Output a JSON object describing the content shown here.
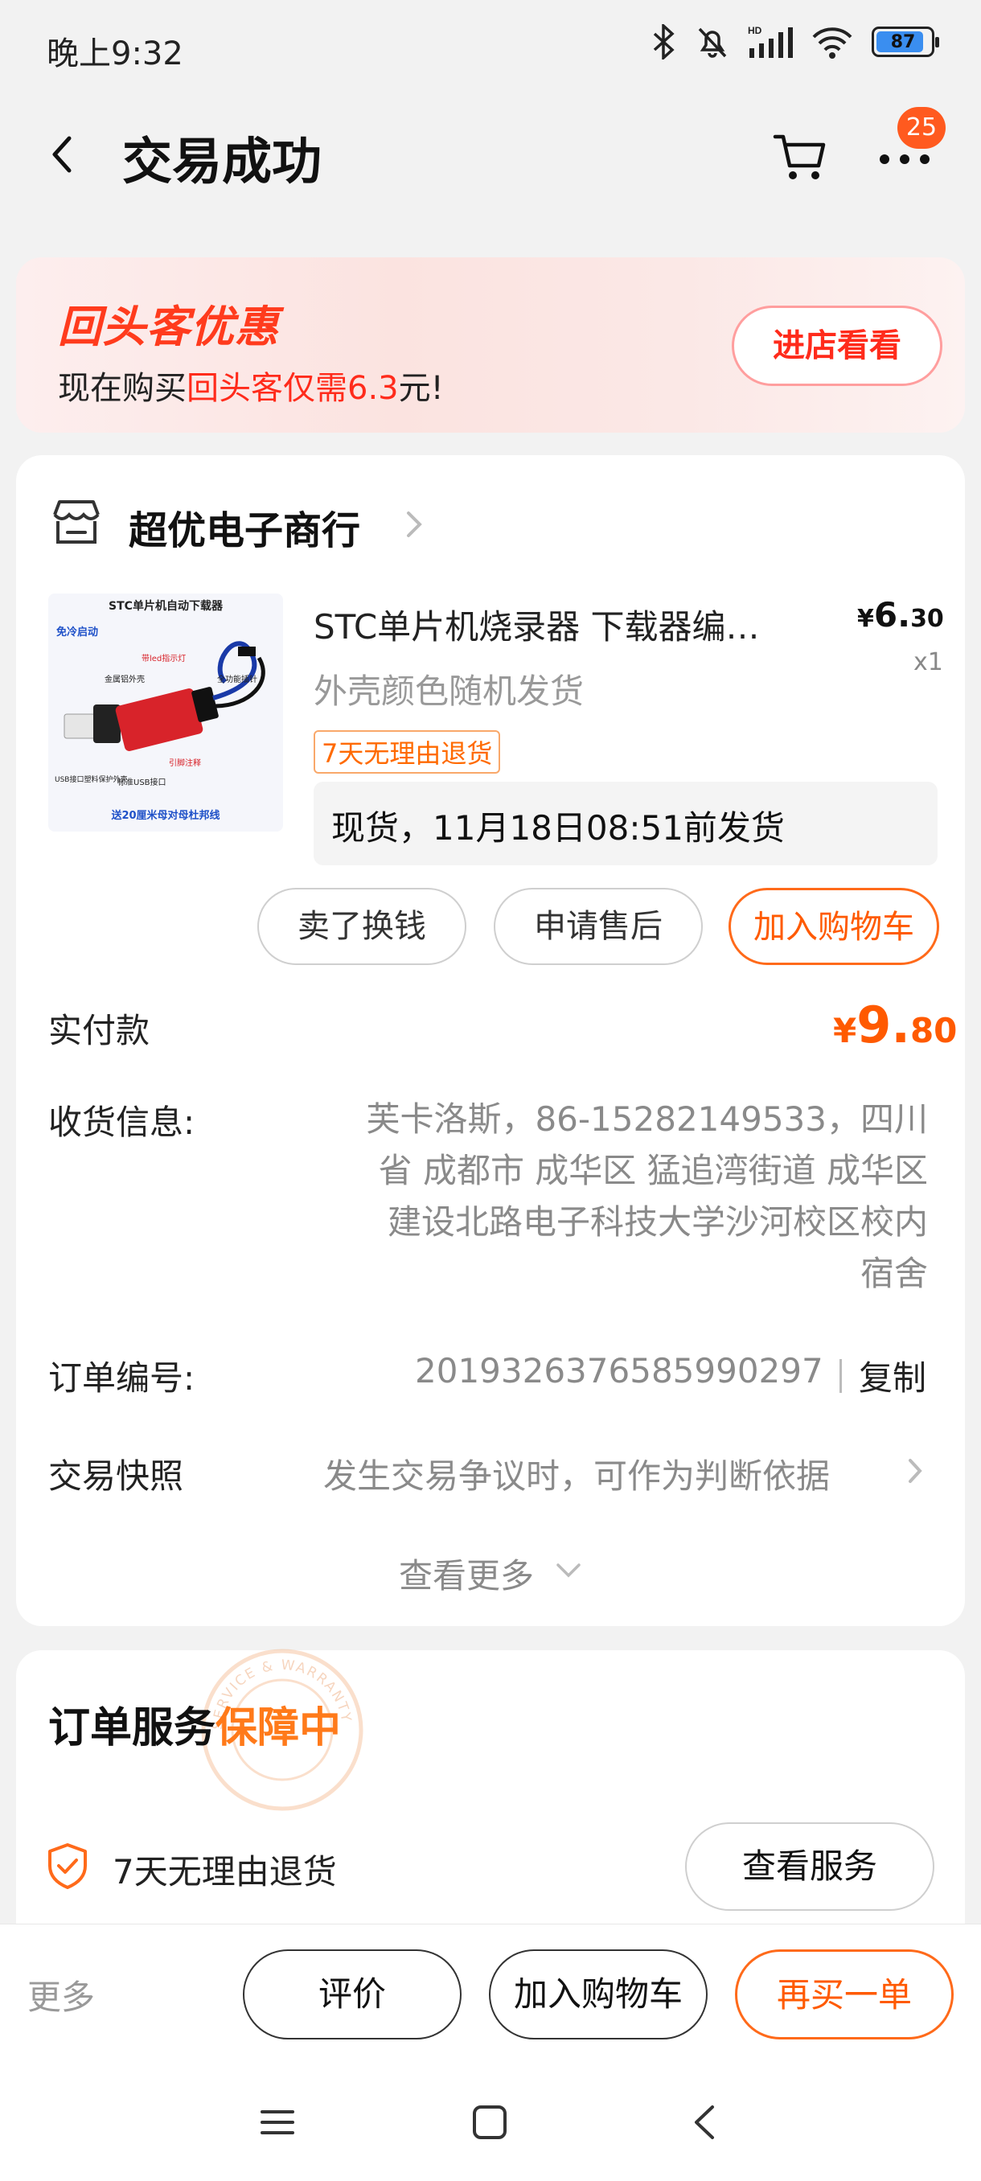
{
  "status_bar": {
    "time": "晚上9:32",
    "battery": "87"
  },
  "header": {
    "title": "交易成功",
    "badge_count": "25"
  },
  "promo": {
    "logo": "回头客优惠",
    "text_prefix": "现在购买",
    "text_highlight": "回头客仅需6.3",
    "text_suffix": "元!",
    "button": "进店看看"
  },
  "store": {
    "name": "超优电子商行"
  },
  "product": {
    "title": "STC单片机烧录器 下载器编…",
    "price_symbol": "¥",
    "price_int": "6.",
    "price_dec": "30",
    "quantity": "x1",
    "sku": "外壳颜色随机发货",
    "tag": "7天无理由退货",
    "shipping": "现货，11月18日08:51前发货",
    "image_texts": {
      "heading": "STC单片机自动下载器",
      "cold_start": "免冷启动",
      "led": "带led指示灯",
      "shell": "金属铝外壳",
      "gold_pin": "全功能插针",
      "usb_protect": "USB接口塑料保护外壳",
      "std_usb": "标准USB接口",
      "pin_note": "引脚注释",
      "cable": "送20厘米母对母杜邦线"
    }
  },
  "actions": {
    "sell": "卖了换钱",
    "after_sale": "申请售后",
    "add_cart": "加入购物车"
  },
  "order": {
    "paid_label": "实付款",
    "paid_symbol": "¥",
    "paid_int": "9.",
    "paid_dec": "80",
    "shipping_label": "收货信息:",
    "address_lines": [
      "芙卡洛斯，86-15282149533，四川",
      "省 成都市 成华区 猛追湾街道 成华区",
      "建设北路电子科技大学沙河校区校内",
      "宿舍"
    ],
    "order_no_label": "订单编号:",
    "order_no": "2019326376585990297",
    "copy": "复制",
    "snapshot_label": "交易快照",
    "snapshot_text": "发生交易争议时，可作为判断依据",
    "see_more": "查看更多"
  },
  "service": {
    "title_prefix": "订单服务",
    "title_status": "保障中",
    "seal_text": "SERVICE & WARRANTY",
    "item": "7天无理由退货",
    "view_button": "查看服务"
  },
  "bottom_bar": {
    "more": "更多",
    "review": "评价",
    "add_cart": "加入购物车",
    "buy_again": "再买一单"
  },
  "colors": {
    "accent": "#ff5a00",
    "promo_red": "#ff2b1b",
    "badge": "#ff5a1f"
  }
}
